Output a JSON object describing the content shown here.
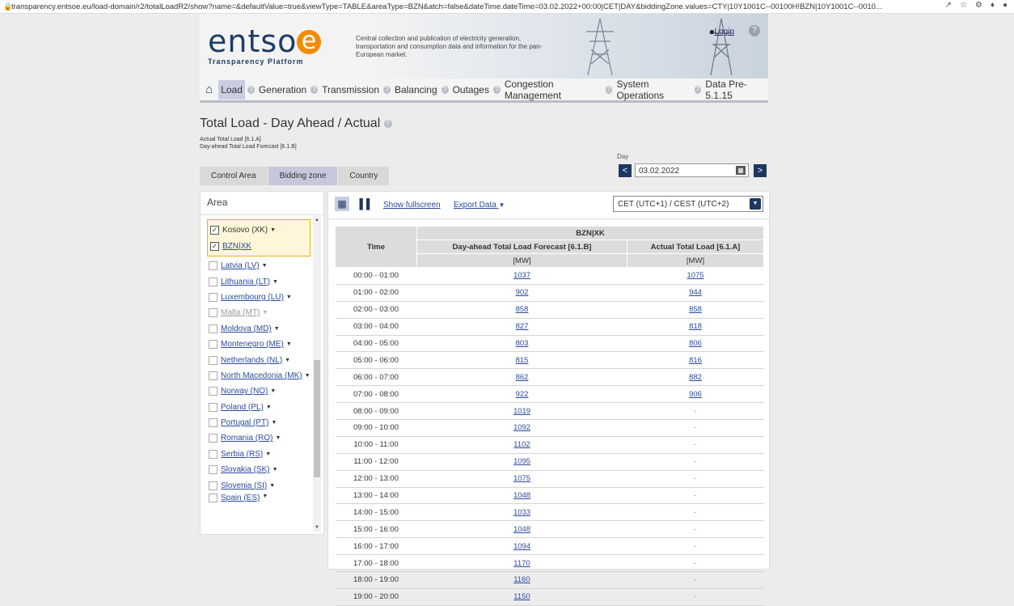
{
  "browser": {
    "url": "transparency.entsoe.eu/load-domain/r2/totalLoadR2/show?name=&defaultValue=true&viewType=TABLE&areaType=BZN&atch=false&dateTime.dateTime=03.02.2022+00:00|CET|DAY&biddingZone.values=CTY|10Y1001C--00100H!BZN|10Y1001C--0010..."
  },
  "header": {
    "logo_text": "entso",
    "logo_e": "e",
    "logo_sub": "Transparency Platform",
    "tagline": "Central collection and publication of electricity generation, transportation and consumption data and information for the pan-European market.",
    "login": "Login",
    "help": "?"
  },
  "nav": {
    "items": [
      "Load",
      "Generation",
      "Transmission",
      "Balancing",
      "Outages",
      "Congestion Management",
      "System Operations",
      "Data Pre-5.1.15"
    ],
    "q": "?"
  },
  "page": {
    "title": "Total Load - Day Ahead / Actual",
    "sub1": "Actual Total Load [6.1.A]",
    "sub2": "Day-ahead Total Load Forecast [6.1.B]"
  },
  "tabs": [
    "Control Area",
    "Bidding zone",
    "Country"
  ],
  "day": {
    "label": "Day",
    "value": "03.02.2022",
    "prev": "<",
    "next": ">"
  },
  "sidebar": {
    "title": "Area",
    "selected": [
      {
        "label": "Kosovo (XK)",
        "checked": true,
        "arrow": true
      },
      {
        "label": "BZN|XK",
        "checked": true,
        "arrow": false
      }
    ],
    "items": [
      {
        "label": "Latvia (LV)",
        "dim": false
      },
      {
        "label": "Lithuania (LT)",
        "dim": false
      },
      {
        "label": "Luxembourg (LU)",
        "dim": false
      },
      {
        "label": "Malta (MT)",
        "dim": true
      },
      {
        "label": "Moldova (MD)",
        "dim": false
      },
      {
        "label": "Montenegro (ME)",
        "dim": false
      },
      {
        "label": "Netherlands (NL)",
        "dim": false
      },
      {
        "label": "North Macedonia (MK)",
        "dim": false
      },
      {
        "label": "Norway (NO)",
        "dim": false
      },
      {
        "label": "Poland (PL)",
        "dim": false
      },
      {
        "label": "Portugal (PT)",
        "dim": false
      },
      {
        "label": "Romania (RO)",
        "dim": false
      },
      {
        "label": "Serbia (RS)",
        "dim": false
      },
      {
        "label": "Slovakia (SK)",
        "dim": false
      },
      {
        "label": "Slovenia (SI)",
        "dim": false
      },
      {
        "label": "Spain (ES)",
        "dim": false
      }
    ]
  },
  "toolbar": {
    "fullscreen": "Show fullscreen",
    "export": "Export Data",
    "timezone": "CET (UTC+1) / CEST (UTC+2)"
  },
  "table": {
    "zone": "BZN|XK",
    "time_header": "Time",
    "col1": "Day-ahead Total Load Forecast [6.1.B]",
    "col2": "Actual Total Load [6.1.A]",
    "unit": "[MW]",
    "rows": [
      [
        "00:00 - 01:00",
        "1037",
        "1075"
      ],
      [
        "01:00 - 02:00",
        "902",
        "944"
      ],
      [
        "02:00 - 03:00",
        "858",
        "858"
      ],
      [
        "03:00 - 04:00",
        "827",
        "818"
      ],
      [
        "04:00 - 05:00",
        "803",
        "806"
      ],
      [
        "05:00 - 06:00",
        "815",
        "816"
      ],
      [
        "06:00 - 07:00",
        "862",
        "882"
      ],
      [
        "07:00 - 08:00",
        "922",
        "906"
      ],
      [
        "08:00 - 09:00",
        "1019",
        "-"
      ],
      [
        "09:00 - 10:00",
        "1092",
        "-"
      ],
      [
        "10:00 - 11:00",
        "1102",
        "-"
      ],
      [
        "11:00 - 12:00",
        "1095",
        "-"
      ],
      [
        "12:00 - 13:00",
        "1075",
        "-"
      ],
      [
        "13:00 - 14:00",
        "1048",
        "-"
      ],
      [
        "14:00 - 15:00",
        "1033",
        "-"
      ],
      [
        "15:00 - 16:00",
        "1048",
        "-"
      ],
      [
        "16:00 - 17:00",
        "1094",
        "-"
      ],
      [
        "17:00 - 18:00",
        "1170",
        "-"
      ],
      [
        "18:00 - 19:00",
        "1160",
        "-"
      ],
      [
        "19:00 - 20:00",
        "1150",
        "-"
      ]
    ]
  }
}
